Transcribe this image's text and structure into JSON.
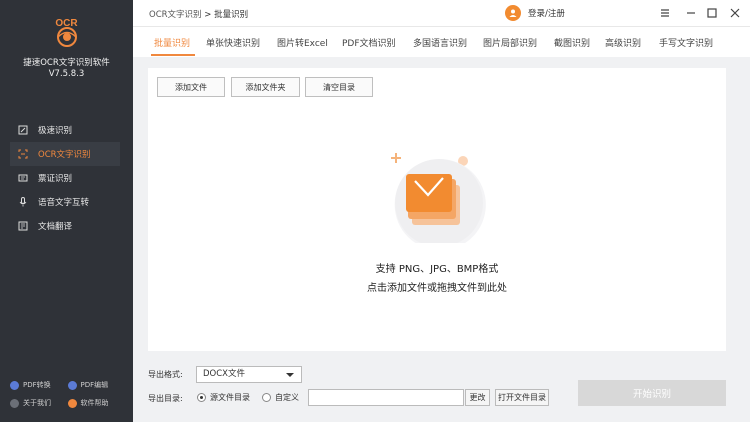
{
  "app": {
    "logo_text": "OCR",
    "name": "捷速OCR文字识别软件",
    "version": "V7.5.8.3"
  },
  "sidebar": {
    "items": [
      {
        "label": "极速识别",
        "icon": "speed-icon"
      },
      {
        "label": "OCR文字识别",
        "icon": "scan-icon",
        "active": true
      },
      {
        "label": "票证识别",
        "icon": "ticket-icon"
      },
      {
        "label": "语音文字互转",
        "icon": "microphone-icon"
      },
      {
        "label": "文档翻译",
        "icon": "translate-icon"
      }
    ],
    "footer": [
      {
        "label": "PDF转换",
        "icon": "pdf-convert-icon",
        "color": "#5b7bd6"
      },
      {
        "label": "PDF编辑",
        "icon": "pdf-edit-icon",
        "color": "#5b7bd6"
      },
      {
        "label": "关于我们",
        "icon": "about-icon",
        "color": "#6b6f77"
      },
      {
        "label": "软件帮助",
        "icon": "help-icon",
        "color": "#f0883e"
      }
    ]
  },
  "header": {
    "breadcrumb_parent": "OCR文字识别",
    "breadcrumb_current": "> 批量识别",
    "login_label": "登录/注册"
  },
  "tabs": [
    "批量识别",
    "单张快速识别",
    "图片转Excel",
    "PDF文档识别",
    "多国语言识别",
    "图片局部识别",
    "截图识别",
    "高级识别",
    "手写文字识别"
  ],
  "toolbar": {
    "add_file": "添加文件",
    "add_folder": "添加文件夹",
    "clear_list": "清空目录"
  },
  "empty_state": {
    "line1": "支持 PNG、JPG、BMP格式",
    "line2": "点击添加文件或拖拽文件到此处"
  },
  "export": {
    "format_label": "导出格式:",
    "format_value": "DOCX文件",
    "dir_label": "导出目录:",
    "radio_source": "源文件目录",
    "radio_custom": "自定义",
    "change_button": "更改",
    "open_folder_button": "打开文件目录",
    "start_button": "开始识别"
  },
  "colors": {
    "accent": "#f0883e",
    "sidebar_bg": "#2f3238"
  }
}
